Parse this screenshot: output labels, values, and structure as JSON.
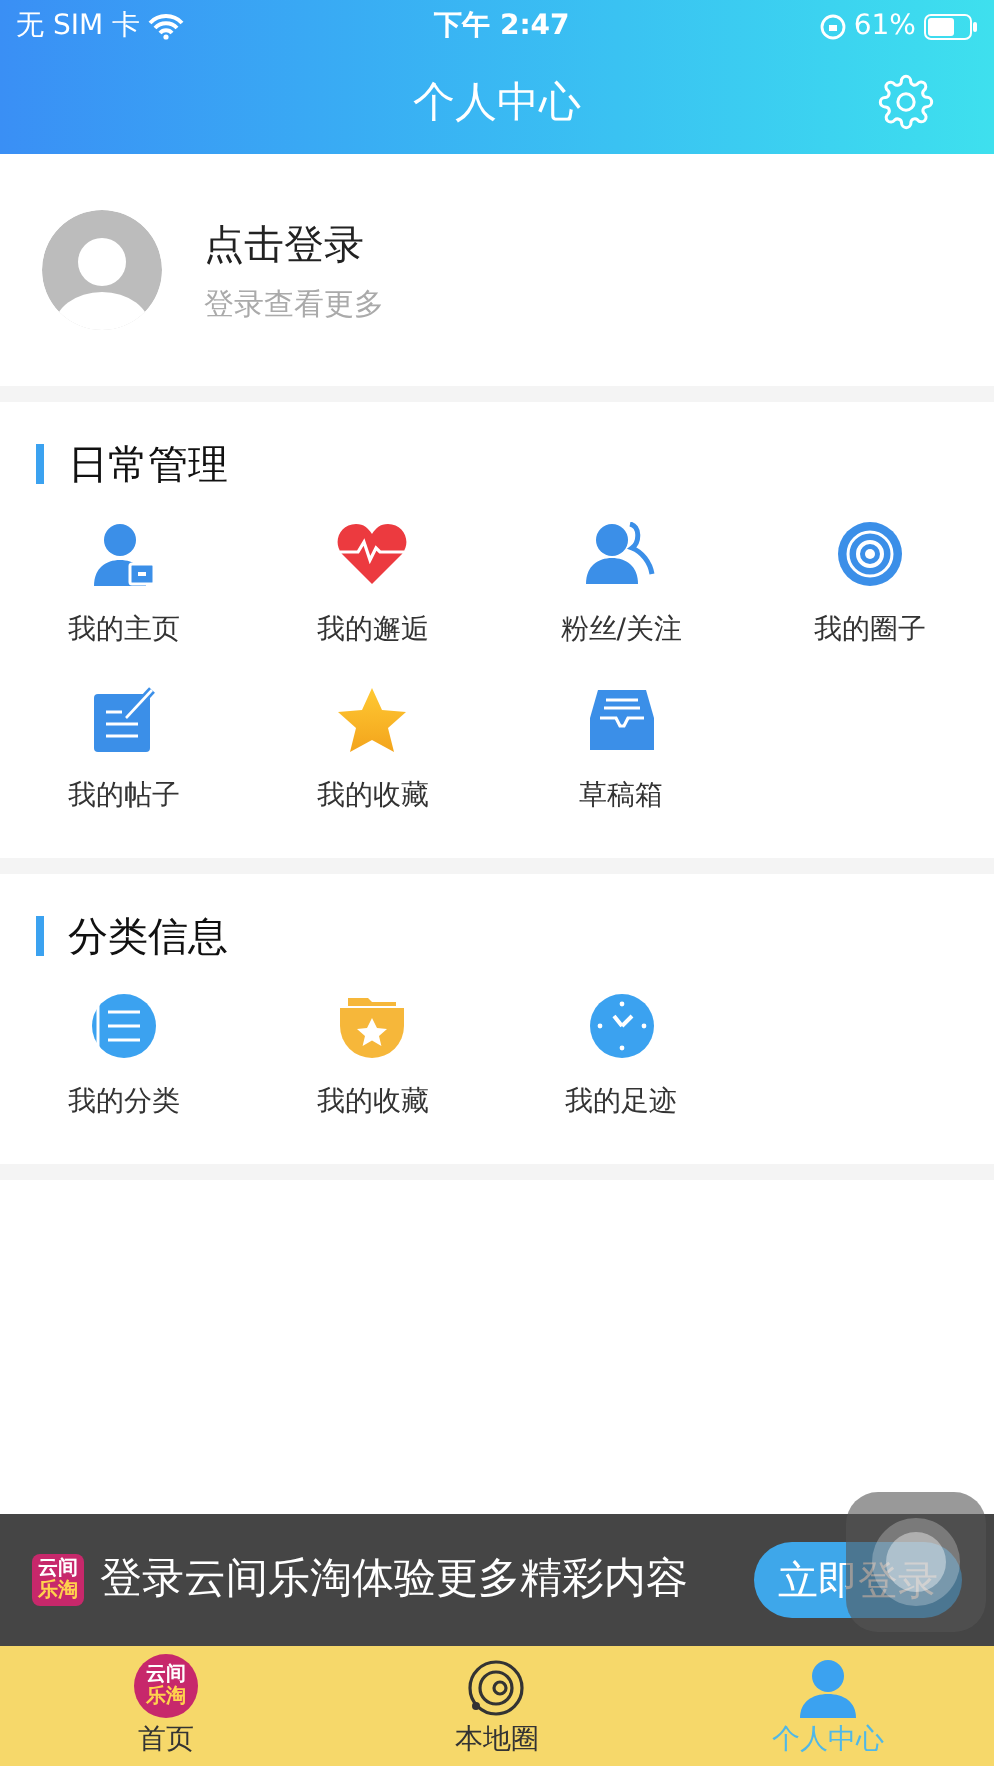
{
  "status_bar": {
    "carrier": "无 SIM 卡",
    "time": "下午 2:47",
    "battery": "61%"
  },
  "header": {
    "title": "个人中心"
  },
  "profile": {
    "name": "点击登录",
    "subtitle": "登录查看更多"
  },
  "sections": [
    {
      "title": "日常管理",
      "items": [
        {
          "label": "我的主页"
        },
        {
          "label": "我的邂逅"
        },
        {
          "label": "粉丝/关注"
        },
        {
          "label": "我的圈子"
        },
        {
          "label": "我的帖子"
        },
        {
          "label": "我的收藏"
        },
        {
          "label": "草稿箱"
        }
      ]
    },
    {
      "title": "分类信息",
      "items": [
        {
          "label": "我的分类"
        },
        {
          "label": "我的收藏"
        },
        {
          "label": "我的足迹"
        }
      ]
    }
  ],
  "banner": {
    "logo": [
      "云间",
      "乐淘"
    ],
    "text": "登录云间乐淘体验更多精彩内容",
    "button": "立即登录"
  },
  "tabs": [
    {
      "label": "首页",
      "logo": [
        "云间",
        "乐淘"
      ],
      "selected": false
    },
    {
      "label": "本地圈",
      "selected": false
    },
    {
      "label": "个人中心",
      "selected": true
    }
  ]
}
